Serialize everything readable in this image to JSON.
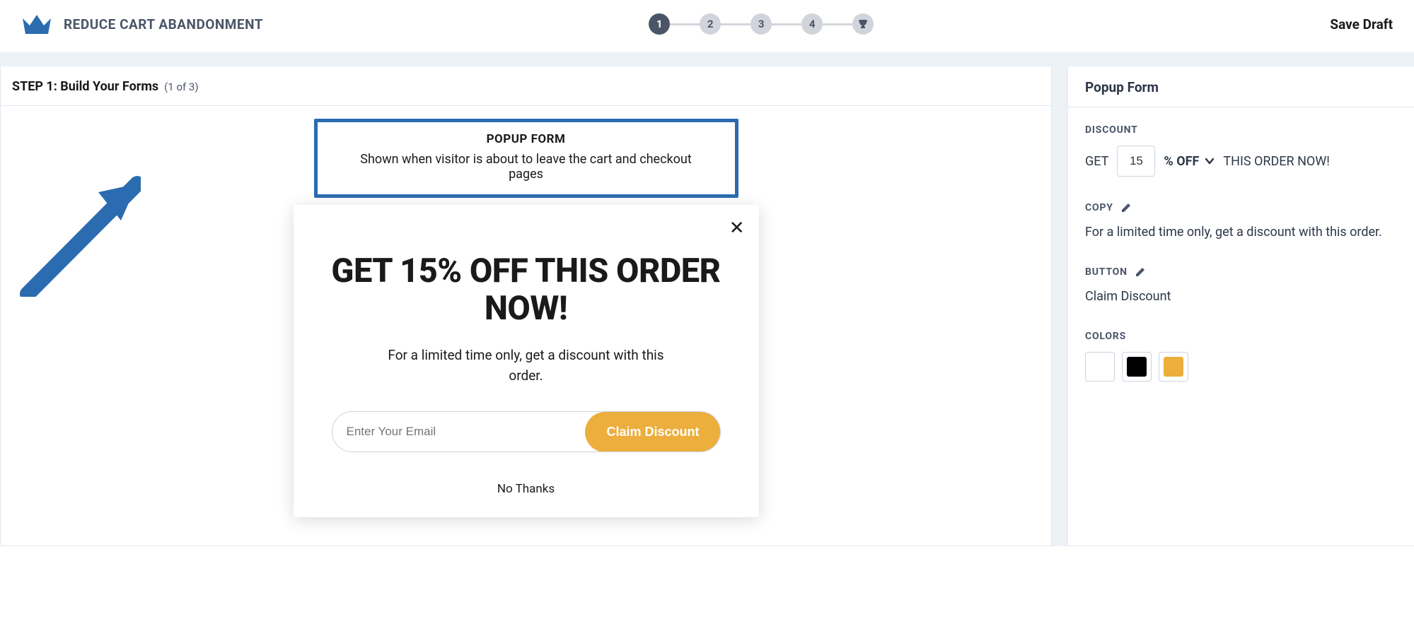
{
  "header": {
    "title": "REDUCE CART ABANDONMENT",
    "save_draft": "Save Draft",
    "steps": [
      "1",
      "2",
      "3",
      "4"
    ]
  },
  "main": {
    "step_title": "STEP 1: Build Your Forms",
    "step_count": "(1 of 3)",
    "form_selector": {
      "title": "POPUP FORM",
      "desc": "Shown when visitor is about to leave the cart and checkout pages"
    },
    "popup": {
      "headline": "GET 15% OFF THIS ORDER NOW!",
      "copy": "For a limited time only, get a discount with this order.",
      "email_placeholder": "Enter Your Email",
      "claim_button": "Claim Discount",
      "no_thanks": "No Thanks"
    }
  },
  "side": {
    "title": "Popup Form",
    "discount": {
      "label": "DISCOUNT",
      "word_get": "GET",
      "value": "15",
      "pct_off": "% OFF",
      "suffix": "THIS ORDER NOW!"
    },
    "copy": {
      "label": "COPY",
      "value": "For a limited time only, get a discount with this order."
    },
    "button": {
      "label": "BUTTON",
      "value": "Claim Discount"
    },
    "colors": {
      "label": "COLORS",
      "swatches": [
        "#ffffff",
        "#000000",
        "#ecae3c"
      ]
    }
  }
}
